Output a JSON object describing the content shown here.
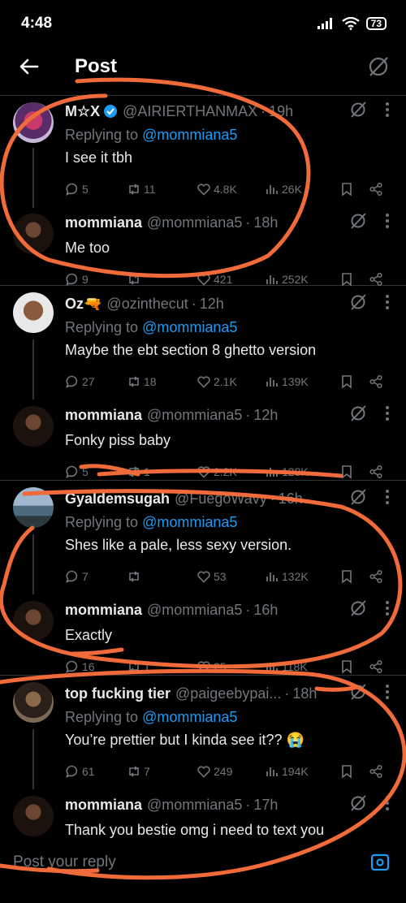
{
  "status": {
    "time": "4:48",
    "battery": "73"
  },
  "header": {
    "title": "Post"
  },
  "colors": {
    "accent": "#1d9bf0",
    "scribble": "#f06a3a",
    "muted": "#71767b"
  },
  "tweets": [
    {
      "name": "M☆X",
      "handle": "@AIRIERTHANMAX",
      "time": "19h",
      "verified": true,
      "reply_prefix": "Replying to",
      "reply_to": "@mommiana5",
      "text": "I see it tbh",
      "replies": "5",
      "retweets": "11",
      "likes": "4.8K",
      "views": "26K"
    },
    {
      "name": "mommiana",
      "handle": "@mommiana5",
      "time": "18h",
      "text": "Me too",
      "replies": "9",
      "retweets": "",
      "likes": "421",
      "views": "252K"
    },
    {
      "name": "Oz🔫",
      "handle": "@ozinthecut",
      "time": "12h",
      "reply_prefix": "Replying to",
      "reply_to": "@mommiana5",
      "text": "Maybe the ebt section 8 ghetto version",
      "replies": "27",
      "retweets": "18",
      "likes": "2.1K",
      "views": "139K"
    },
    {
      "name": "mommiana",
      "handle": "@mommiana5",
      "time": "12h",
      "text": "Fonky piss baby",
      "replies": "5",
      "retweets": "1",
      "likes": "2.2K",
      "views": "128K"
    },
    {
      "name": "Gyaldemsugah",
      "handle": "@FuegoWavy",
      "time": "16h",
      "reply_prefix": "Replying to",
      "reply_to": "@mommiana5",
      "text": "Shes like a pale, less sexy version.",
      "replies": "7",
      "retweets": "",
      "likes": "53",
      "views": "132K"
    },
    {
      "name": "mommiana",
      "handle": "@mommiana5",
      "time": "16h",
      "text": "Exactly",
      "replies": "16",
      "retweets": "1",
      "likes": "25",
      "views": "118K"
    },
    {
      "name": "top fucking tier",
      "handle": "@paigeebypai...",
      "time": "18h",
      "reply_prefix": "Replying to",
      "reply_to": "@mommiana5",
      "text": "You’re prettier but I kinda see it?? 😭",
      "replies": "61",
      "retweets": "7",
      "likes": "249",
      "views": "194K"
    },
    {
      "name": "mommiana",
      "handle": "@mommiana5",
      "time": "17h",
      "text": "Thank you bestie omg i need to text you"
    }
  ],
  "reply_bar": {
    "placeholder": "Post your reply"
  }
}
